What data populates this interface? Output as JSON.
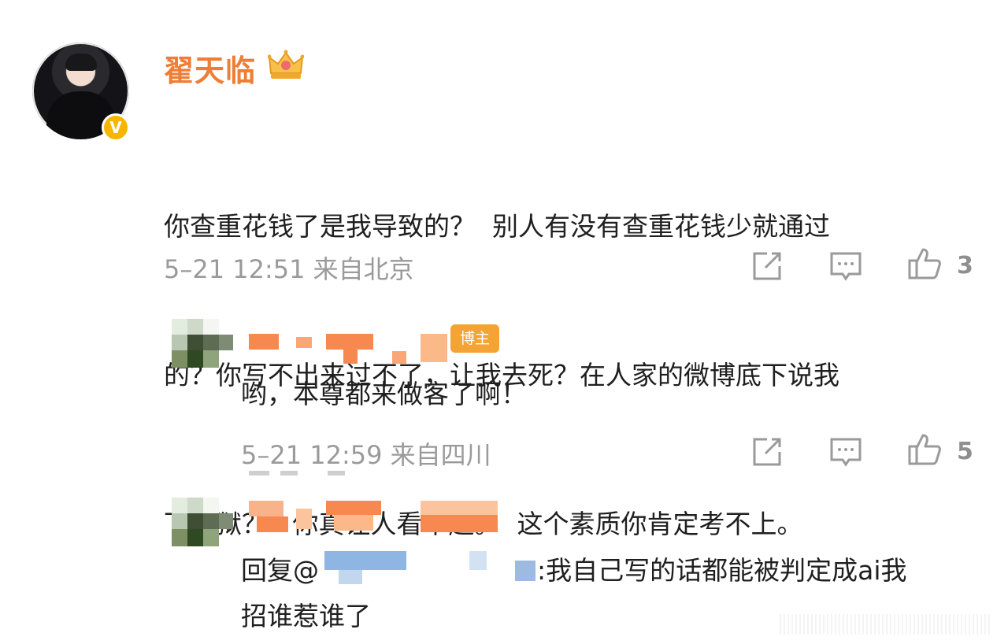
{
  "comment": {
    "author_name": "翟天临",
    "verified_icon": "verified-v-icon",
    "crown_icon": "crown-icon",
    "text_lines": [
      "你查重花钱了是我导致的？  别人有没有查重花钱少就通过",
      "的？你写不出来过不了，让我去死？在人家的微博底下说我",
      "下地狱？   你真让人看不起。  这个素质你肯定考不上。"
    ],
    "meta": "5–21 12:51 来自北京",
    "like_count": "3"
  },
  "reply1": {
    "badge": "博主",
    "text": "哟，本尊都来做客了啊！",
    "meta": "5–21 12:59 来自四川",
    "like_count": "5"
  },
  "reply2": {
    "prefix": "回复@",
    "text_line1": ":我自己写的话都能被判定成ai我",
    "text_line2": "招谁惹谁了"
  },
  "colors": {
    "author_name": "#ef7d34",
    "badge": "#f4a335",
    "meta": "#9a9a9a",
    "verified": "#f7b500"
  }
}
